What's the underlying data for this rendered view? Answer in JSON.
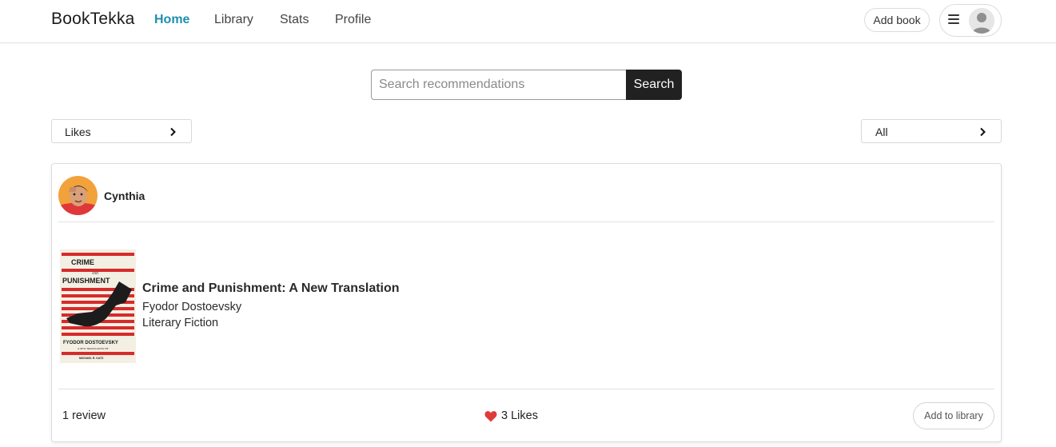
{
  "navbar": {
    "brand": "BookTekka",
    "links": [
      {
        "label": "Home",
        "active": true
      },
      {
        "label": "Library",
        "active": false
      },
      {
        "label": "Stats",
        "active": false
      },
      {
        "label": "Profile",
        "active": false
      }
    ],
    "add_book_label": "Add book",
    "menu_icon": "hamburger-icon",
    "avatar_icon": "user-silhouette-icon"
  },
  "search": {
    "placeholder": "Search recommendations",
    "value": "",
    "button_label": "Search"
  },
  "filters": {
    "left": {
      "selected": "Likes",
      "icon": "chevron-right-icon"
    },
    "right": {
      "selected": "All",
      "icon": "chevron-right-icon"
    }
  },
  "recommendation": {
    "user": {
      "name": "Cynthia",
      "avatar": "user-photo"
    },
    "book": {
      "title": "Crime and Punishment: A New Translation",
      "author": "Fyodor Dostoevsky",
      "genre": "Literary Fiction",
      "cover": {
        "title_line1": "CRIME",
        "title_line2": "AND",
        "title_line3": "PUNISHMENT",
        "author": "FYODOR DOSTOEVSKY",
        "subtitle": "A NEW TRANSLATION BY",
        "translator": "MICHAEL R. KATZ"
      }
    },
    "reviews_label": "1 review",
    "likes_label": "3 Likes",
    "heart_icon": "heart-icon",
    "add_to_library_label": "Add to library"
  },
  "colors": {
    "accent": "#1d8fb0",
    "search_button": "#212121",
    "heart": "#e03b3b",
    "cover_stripe": "#d62b2b"
  }
}
